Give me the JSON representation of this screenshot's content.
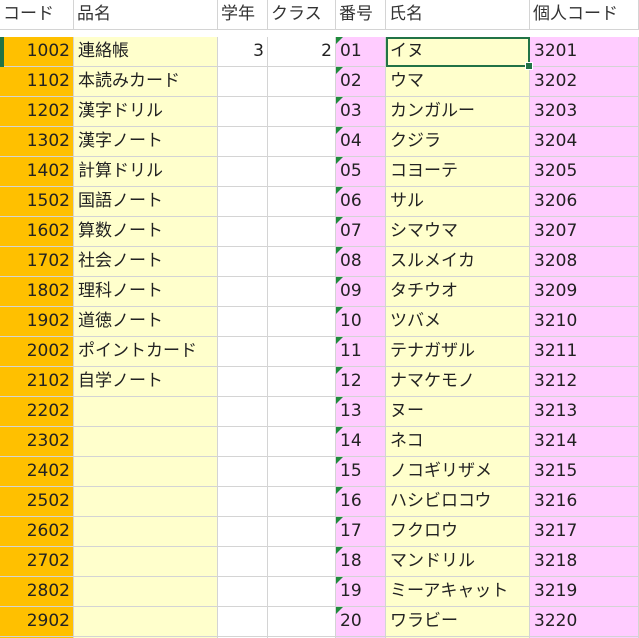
{
  "headers": {
    "code": "コード",
    "item_name": "品名",
    "grade": "学年",
    "class": "クラス",
    "number": "番号",
    "full_name": "氏名",
    "personal_code": "個人コード"
  },
  "rows": [
    {
      "code": "1002",
      "item": "連絡帳",
      "grade": "3",
      "cls": "2",
      "num": "01",
      "name": "イヌ",
      "pcode": "3201"
    },
    {
      "code": "1102",
      "item": "本読みカード",
      "grade": "",
      "cls": "",
      "num": "02",
      "name": "ウマ",
      "pcode": "3202"
    },
    {
      "code": "1202",
      "item": "漢字ドリル",
      "grade": "",
      "cls": "",
      "num": "03",
      "name": "カンガルー",
      "pcode": "3203"
    },
    {
      "code": "1302",
      "item": "漢字ノート",
      "grade": "",
      "cls": "",
      "num": "04",
      "name": "クジラ",
      "pcode": "3204"
    },
    {
      "code": "1402",
      "item": "計算ドリル",
      "grade": "",
      "cls": "",
      "num": "05",
      "name": "コヨーテ",
      "pcode": "3205"
    },
    {
      "code": "1502",
      "item": "国語ノート",
      "grade": "",
      "cls": "",
      "num": "06",
      "name": "サル",
      "pcode": "3206"
    },
    {
      "code": "1602",
      "item": "算数ノート",
      "grade": "",
      "cls": "",
      "num": "07",
      "name": "シマウマ",
      "pcode": "3207"
    },
    {
      "code": "1702",
      "item": "社会ノート",
      "grade": "",
      "cls": "",
      "num": "08",
      "name": "スルメイカ",
      "pcode": "3208"
    },
    {
      "code": "1802",
      "item": "理科ノート",
      "grade": "",
      "cls": "",
      "num": "09",
      "name": "タチウオ",
      "pcode": "3209"
    },
    {
      "code": "1902",
      "item": "道徳ノート",
      "grade": "",
      "cls": "",
      "num": "10",
      "name": "ツバメ",
      "pcode": "3210"
    },
    {
      "code": "2002",
      "item": "ポイントカード",
      "grade": "",
      "cls": "",
      "num": "11",
      "name": "テナガザル",
      "pcode": "3211"
    },
    {
      "code": "2102",
      "item": "自学ノート",
      "grade": "",
      "cls": "",
      "num": "12",
      "name": "ナマケモノ",
      "pcode": "3212"
    },
    {
      "code": "2202",
      "item": "",
      "grade": "",
      "cls": "",
      "num": "13",
      "name": "ヌー",
      "pcode": "3213"
    },
    {
      "code": "2302",
      "item": "",
      "grade": "",
      "cls": "",
      "num": "14",
      "name": "ネコ",
      "pcode": "3214"
    },
    {
      "code": "2402",
      "item": "",
      "grade": "",
      "cls": "",
      "num": "15",
      "name": "ノコギリザメ",
      "pcode": "3215"
    },
    {
      "code": "2502",
      "item": "",
      "grade": "",
      "cls": "",
      "num": "16",
      "name": "ハシビロコウ",
      "pcode": "3216"
    },
    {
      "code": "2602",
      "item": "",
      "grade": "",
      "cls": "",
      "num": "17",
      "name": "フクロウ",
      "pcode": "3217"
    },
    {
      "code": "2702",
      "item": "",
      "grade": "",
      "cls": "",
      "num": "18",
      "name": "マンドリル",
      "pcode": "3218"
    },
    {
      "code": "2802",
      "item": "",
      "grade": "",
      "cls": "",
      "num": "19",
      "name": "ミーアキャット",
      "pcode": "3219"
    },
    {
      "code": "2902",
      "item": "",
      "grade": "",
      "cls": "",
      "num": "20",
      "name": "ワラビー",
      "pcode": "3220"
    },
    {
      "code": "",
      "item": "",
      "grade": "",
      "cls": "",
      "num": "",
      "name": "",
      "pcode": ""
    }
  ],
  "colors": {
    "code_column": "#ffc000",
    "name_columns": "#ffffcc",
    "pink_columns": "#ffccff",
    "selection": "#217346",
    "error_triangle": "#1f8a3c"
  }
}
